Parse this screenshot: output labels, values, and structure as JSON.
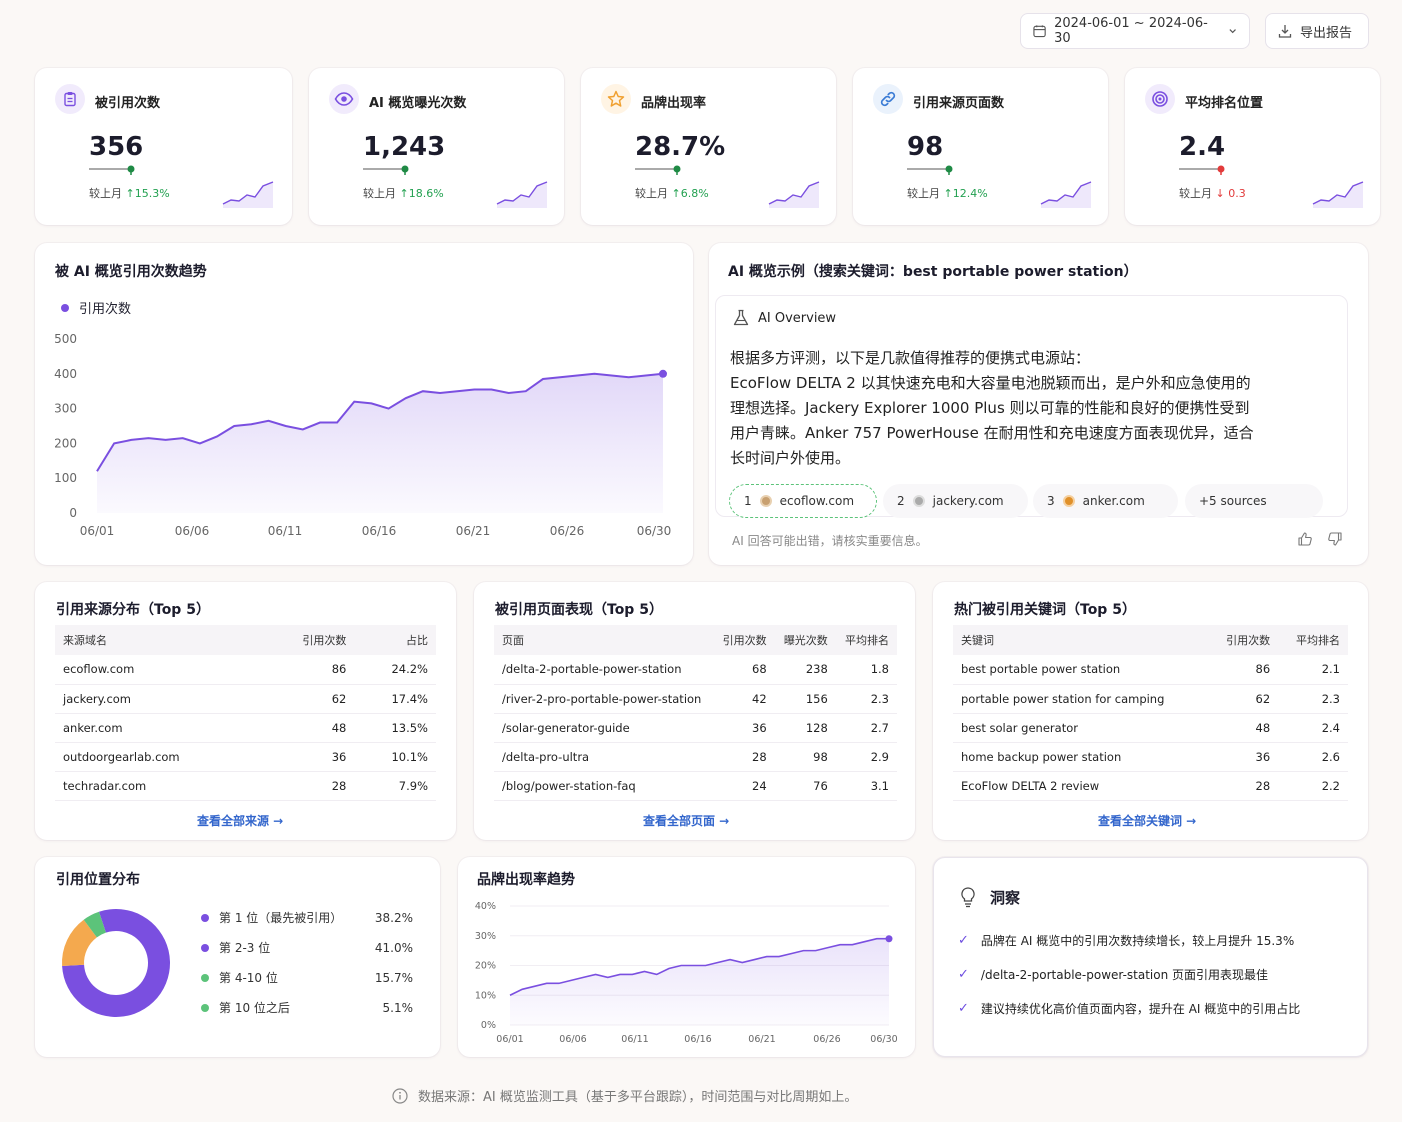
{
  "toolbar": {
    "date_range": "2024-06-01 ~ 2024-06-30",
    "export_label": "导出报告"
  },
  "kpis": [
    {
      "title": "被引用次数",
      "value": "356",
      "compare": "较上月",
      "delta": "↑15.3%",
      "direction": "up",
      "icon": "clipboard-icon",
      "color": "#7a4fe0"
    },
    {
      "title": "AI 概览曝光次数",
      "value": "1,243",
      "compare": "较上月",
      "delta": "↑18.6%",
      "direction": "up",
      "icon": "eye-icon",
      "color": "#7a4fe0"
    },
    {
      "title": "品牌出现率",
      "value": "28.7%",
      "compare": "较上月",
      "delta": "↑6.8%",
      "direction": "up",
      "icon": "star-icon",
      "color": "#f0a030"
    },
    {
      "title": "引用来源页面数",
      "value": "98",
      "compare": "较上月",
      "delta": "↑12.4%",
      "direction": "up",
      "icon": "link-icon",
      "color": "#3a7bd5"
    },
    {
      "title": "平均排名位置",
      "value": "2.4",
      "compare": "较上月",
      "delta": "↓ 0.3",
      "direction": "down",
      "icon": "target-icon",
      "color": "#7a4fe0"
    }
  ],
  "trend": {
    "title": "被 AI 概览引用次数趋势",
    "legend": "引用次数",
    "yticks": [
      "500",
      "400",
      "300",
      "200",
      "100",
      "0"
    ],
    "xticks": [
      "06/01",
      "06/06",
      "06/11",
      "06/16",
      "06/21",
      "06/26",
      "06/30"
    ]
  },
  "chart_data": [
    {
      "type": "area",
      "title": "被 AI 概览引用次数趋势",
      "series": [
        {
          "name": "引用次数",
          "values": [
            120,
            200,
            210,
            215,
            210,
            215,
            200,
            220,
            250,
            255,
            265,
            250,
            240,
            260,
            260,
            320,
            315,
            300,
            330,
            350,
            345,
            350,
            355,
            355,
            345,
            350,
            385,
            390,
            395,
            400,
            395,
            390,
            395,
            400
          ]
        }
      ],
      "ylim": [
        0,
        500
      ],
      "xlabels": [
        "06/01",
        "06/06",
        "06/11",
        "06/16",
        "06/21",
        "06/26",
        "06/30"
      ]
    },
    {
      "type": "pie",
      "title": "引用位置分布",
      "categories": [
        "第 1 位（最先被引用）",
        "第 2-3 位",
        "第 4-10 位",
        "第 10 位之后"
      ],
      "values": [
        38.2,
        41.0,
        15.7,
        5.1
      ]
    },
    {
      "type": "area",
      "title": "品牌出现率趋势",
      "series": [
        {
          "values": [
            10,
            12,
            13,
            14,
            14,
            15,
            16,
            17,
            16,
            17,
            17,
            18,
            17,
            19,
            20,
            20,
            20,
            21,
            22,
            21,
            22,
            23,
            23,
            24,
            25,
            25,
            26,
            27,
            27,
            28,
            29,
            29
          ]
        }
      ],
      "ylim": [
        0,
        40
      ],
      "yticks": [
        "40%",
        "30%",
        "20%",
        "10%",
        "0%"
      ],
      "xlabels": [
        "06/01",
        "06/06",
        "06/11",
        "06/16",
        "06/21",
        "06/26",
        "06/30"
      ]
    }
  ],
  "overview": {
    "title": "AI 概览示例（搜索关键词：best portable power station）",
    "badge": "AI Overview",
    "lines": [
      "根据多方评测，以下是几款值得推荐的便携式电源站：",
      "EcoFlow DELTA 2 以其快速充电和大容量电池脱颖而出，是户外和应急使用的",
      "理想选择。Jackery Explorer 1000 Plus 则以可靠的性能和良好的便携性受到",
      "用户青睐。Anker 757 PowerHouse 在耐用性和充电速度方面表现优异，适合",
      "长时间户外使用。"
    ],
    "sources": [
      {
        "num": "1",
        "domain": "ecoflow.com"
      },
      {
        "num": "2",
        "domain": "jackery.com"
      },
      {
        "num": "3",
        "domain": "anker.com"
      }
    ],
    "more_sources": "+5 sources",
    "disclaimer": "AI 回答可能出错，请核实重要信息。"
  },
  "sources_table": {
    "title": "引用来源分布（Top 5）",
    "headers": [
      "来源域名",
      "引用次数",
      "占比"
    ],
    "rows": [
      [
        "ecoflow.com",
        "86",
        "24.2%"
      ],
      [
        "jackery.com",
        "62",
        "17.4%"
      ],
      [
        "anker.com",
        "48",
        "13.5%"
      ],
      [
        "outdoorgearlab.com",
        "36",
        "10.1%"
      ],
      [
        "techradar.com",
        "28",
        "7.9%"
      ]
    ],
    "link": "查看全部来源 →"
  },
  "pages_table": {
    "title": "被引用页面表现（Top 5）",
    "headers": [
      "页面",
      "引用次数",
      "曝光次数",
      "平均排名"
    ],
    "rows": [
      [
        "/delta-2-portable-power-station",
        "68",
        "238",
        "1.8"
      ],
      [
        "/river-2-pro-portable-power-station",
        "42",
        "156",
        "2.3"
      ],
      [
        "/solar-generator-guide",
        "36",
        "128",
        "2.7"
      ],
      [
        "/delta-pro-ultra",
        "28",
        "98",
        "2.9"
      ],
      [
        "/blog/power-station-faq",
        "24",
        "76",
        "3.1"
      ]
    ],
    "link": "查看全部页面 →"
  },
  "keywords_table": {
    "title": "热门被引用关键词（Top 5）",
    "headers": [
      "关键词",
      "引用次数",
      "平均排名"
    ],
    "rows": [
      [
        "best portable power station",
        "86",
        "2.1"
      ],
      [
        "portable power station for camping",
        "62",
        "2.3"
      ],
      [
        "best solar generator",
        "48",
        "2.4"
      ],
      [
        "home backup power station",
        "36",
        "2.6"
      ],
      [
        "EcoFlow DELTA 2 review",
        "28",
        "2.2"
      ]
    ],
    "link": "查看全部关键词 →"
  },
  "position": {
    "title": "引用位置分布",
    "items": [
      {
        "label": "第 1 位（最先被引用）",
        "pct": "38.2%",
        "color": "#7a4fe0"
      },
      {
        "label": "第 2-3 位",
        "pct": "41.0%",
        "color": "#7a4fe0"
      },
      {
        "label": "第 4-10 位",
        "pct": "15.7%",
        "color": "#5cc37a"
      },
      {
        "label": "第 10 位之后",
        "pct": "5.1%",
        "color": "#5cc37a"
      }
    ]
  },
  "brand_trend": {
    "title": "品牌出现率趋势",
    "yticks": [
      "40%",
      "30%",
      "20%",
      "10%",
      "0%"
    ],
    "xticks": [
      "06/01",
      "06/06",
      "06/11",
      "06/16",
      "06/21",
      "06/26",
      "06/30"
    ]
  },
  "insights": {
    "title": "洞察",
    "items": [
      "品牌在 AI 概览中的引用次数持续增长，较上月提升 15.3%",
      "/delta-2-portable-power-station 页面引用表现最佳",
      "建议持续优化高价值页面内容，提升在 AI 概览中的引用占比"
    ]
  },
  "footer": "数据来源：AI 概览监测工具（基于多平台跟踪），时间范围与对比周期如上。"
}
